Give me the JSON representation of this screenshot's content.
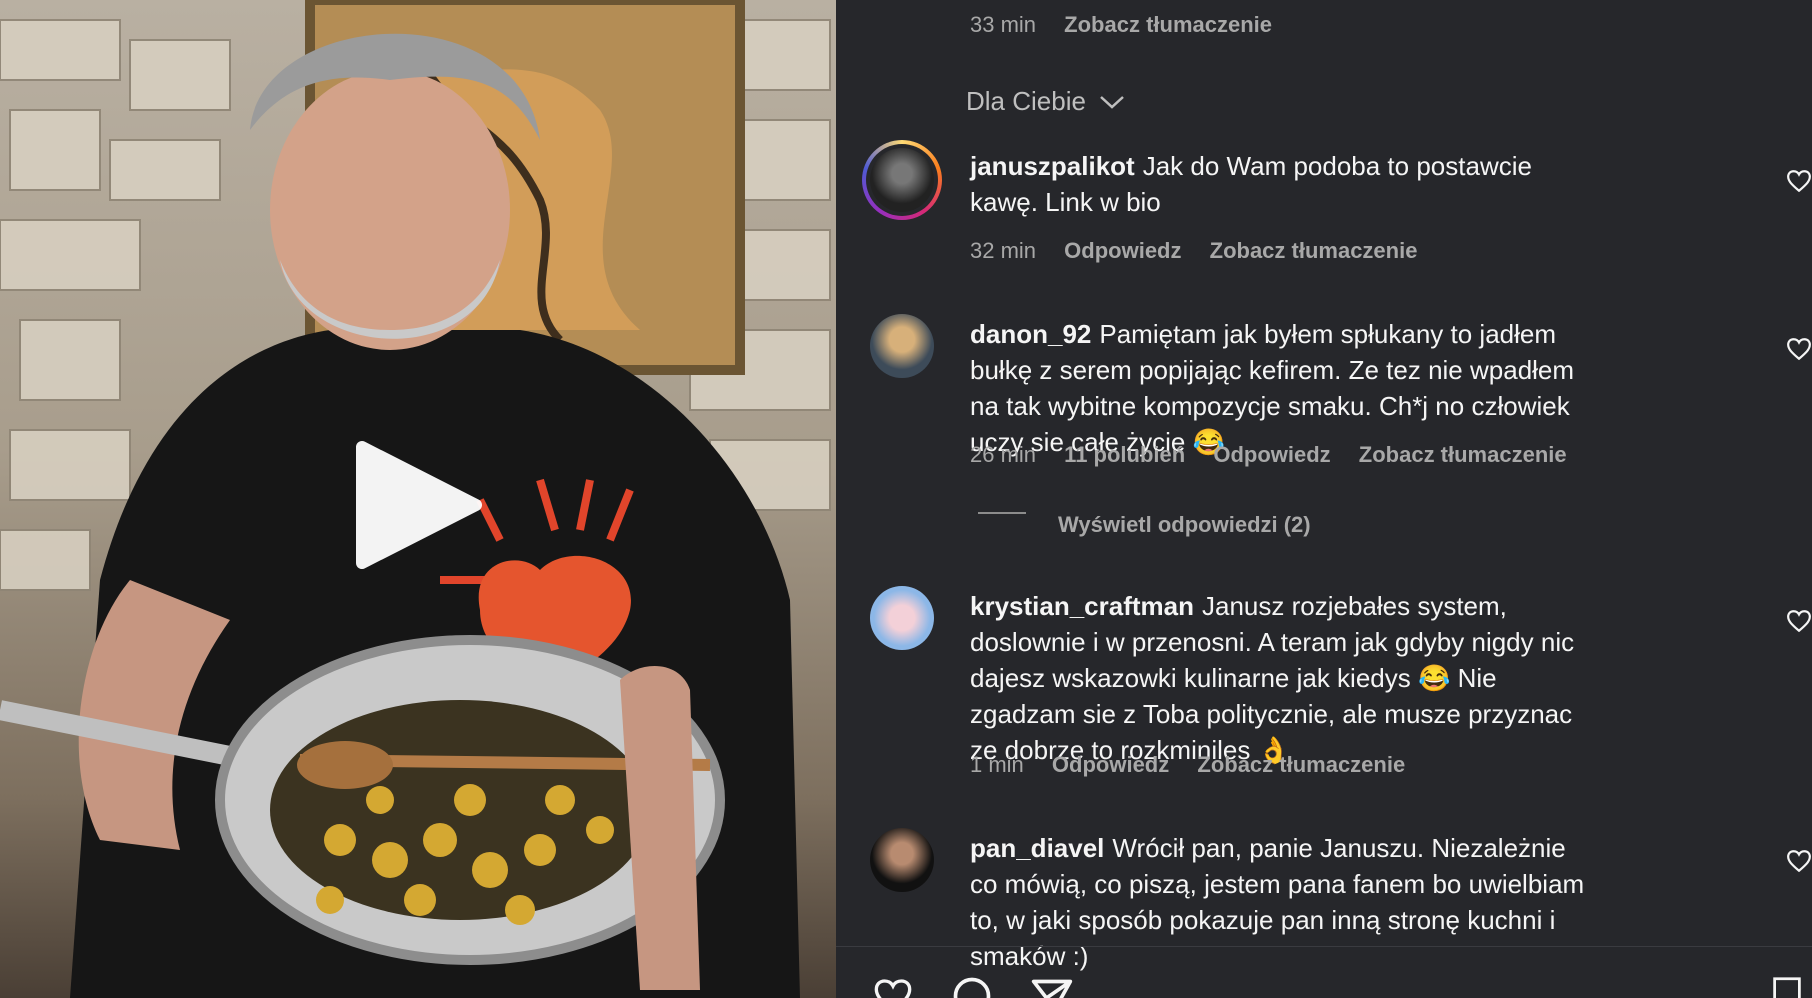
{
  "top": {
    "time": "33 min",
    "translate": "Zobacz tłumaczenie"
  },
  "sort": {
    "label": "Dla Ciebie"
  },
  "comments": [
    {
      "user": "januszpalikot",
      "text": "Jak do Wam podoba to postawcie kawę. Link w bio",
      "time": "32 min",
      "likes": "",
      "reply": "Odpowiedz",
      "translate": "Zobacz tłumaczenie"
    },
    {
      "user": "danon_92",
      "text": "Pamiętam jak byłem spłukany to jadłem bułkę z serem popijając kefirem. Ze tez nie wpadłem na tak wybitne kompozycje smaku. Ch*j no człowiek uczy sie całe życie 😂",
      "time": "26 min",
      "likes": "11 polubień",
      "reply": "Odpowiedz",
      "translate": "Zobacz tłumaczenie"
    },
    {
      "user": "krystian_craftman",
      "text": "Janusz rozjebałes system, doslownie i w przenosni. A teram jak gdyby nigdy nic dajesz wskazowki kulinarne jak kiedys 😂 Nie zgadzam sie z Toba politycznie, ale musze przyznac ze dobrze to rozkminiles 👌",
      "time": "1 min",
      "likes": "",
      "reply": "Odpowiedz",
      "translate": "Zobacz tłumaczenie"
    },
    {
      "user": "pan_diavel",
      "text": "Wrócił pan, panie Januszu. Niezależnie co mówią, co piszą, jestem pana fanem bo uwielbiam to, w jaki sposób pokazuje pan inną stronę kuchni i smaków :)"
    }
  ],
  "replies": {
    "label": "Wyświetl odpowiedzi (2)"
  },
  "icons": [
    "play-icon",
    "heart-icon",
    "comment-icon",
    "share-icon",
    "bookmark-icon",
    "chevron-down-icon"
  ]
}
